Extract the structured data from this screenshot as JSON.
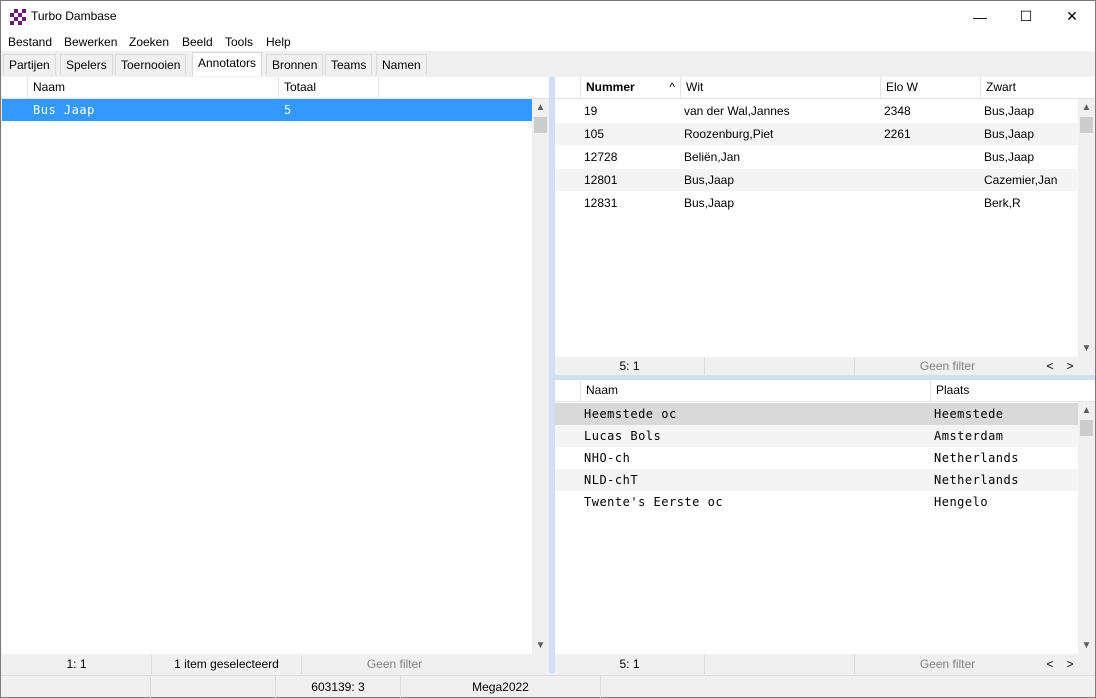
{
  "window": {
    "title": "Turbo Dambase",
    "minimize": "—",
    "maximize": "☐",
    "close": "✕"
  },
  "menu": [
    "Bestand",
    "Bewerken",
    "Zoeken",
    "Beeld",
    "Tools",
    "Help"
  ],
  "tabs": [
    "Partijen",
    "Spelers",
    "Toernooien",
    "Annotators",
    "Bronnen",
    "Teams",
    "Namen"
  ],
  "active_tab": "Annotators",
  "left": {
    "columns": [
      "Naam",
      "Totaal"
    ],
    "rows": [
      {
        "naam": "Bus Jaap",
        "totaal": "5"
      }
    ],
    "status": {
      "position": "1: 1",
      "selected": "1 item geselecteerd",
      "filter": "Geen filter"
    }
  },
  "games": {
    "columns": [
      "Nummer",
      "Wit",
      "Elo W",
      "Zwart"
    ],
    "sort_indicator": "^",
    "rows": [
      {
        "nummer": "19",
        "wit": "van der Wal,Jannes",
        "elo": "2348",
        "zwart": "Bus,Jaap"
      },
      {
        "nummer": "105",
        "wit": "Roozenburg,Piet",
        "elo": "2261",
        "zwart": "Bus,Jaap"
      },
      {
        "nummer": "12728",
        "wit": "Beliën,Jan",
        "elo": "",
        "zwart": "Bus,Jaap"
      },
      {
        "nummer": "12801",
        "wit": "Bus,Jaap",
        "elo": "",
        "zwart": "Cazemier,Jan"
      },
      {
        "nummer": "12831",
        "wit": "Bus,Jaap",
        "elo": "",
        "zwart": "Berk,R"
      }
    ],
    "status": {
      "position": "5: 1",
      "filter": "Geen filter",
      "prev": "<",
      "next": ">"
    }
  },
  "events": {
    "columns": [
      "Naam",
      "Plaats"
    ],
    "rows": [
      {
        "naam": "Heemstede oc",
        "plaats": "Heemstede"
      },
      {
        "naam": "Lucas Bols",
        "plaats": "Amsterdam"
      },
      {
        "naam": "NHO-ch",
        "plaats": "Netherlands"
      },
      {
        "naam": "NLD-chT",
        "plaats": "Netherlands"
      },
      {
        "naam": "Twente's Eerste oc",
        "plaats": "Hengelo"
      }
    ],
    "status": {
      "position": "5: 1",
      "filter": "Geen filter",
      "prev": "<",
      "next": ">"
    }
  },
  "bottom_status": {
    "count": "603139: 3",
    "database": "Mega2022"
  }
}
